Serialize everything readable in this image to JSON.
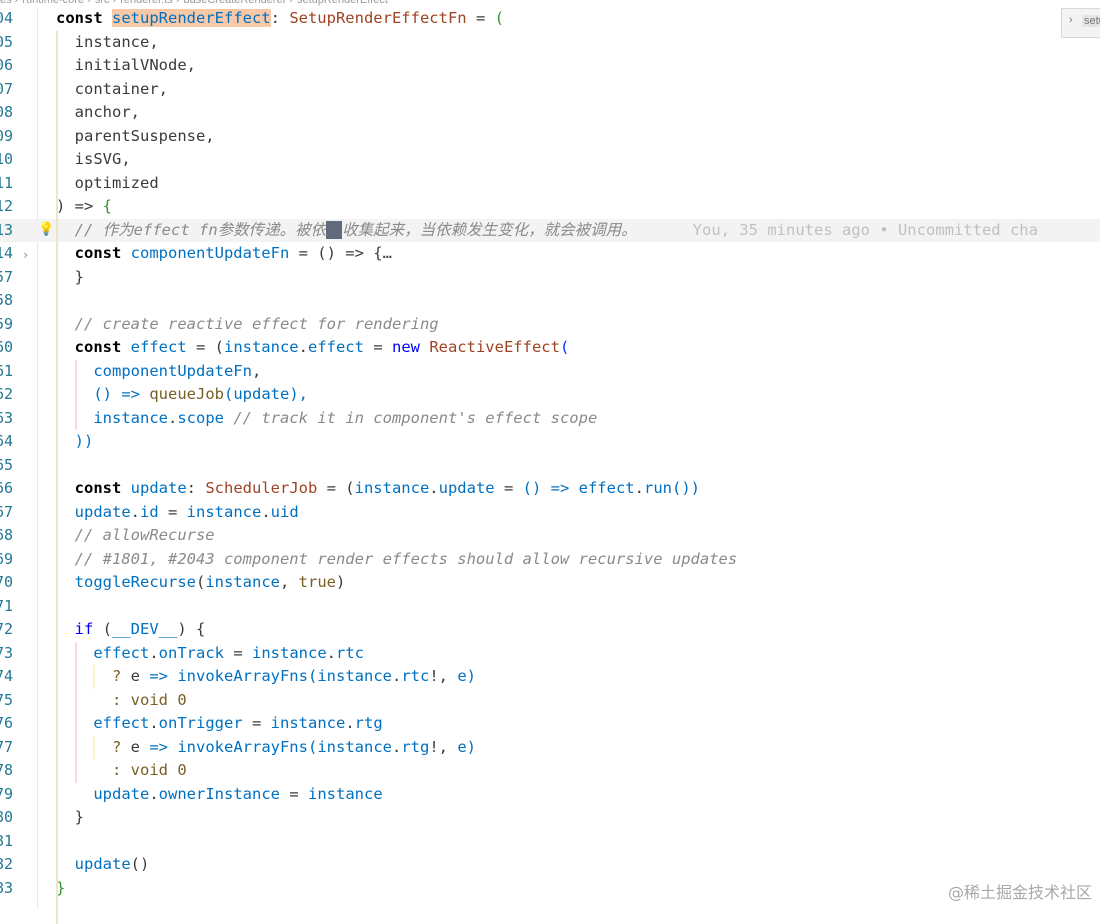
{
  "breadcrumb": [
    "es",
    "runtime-core",
    "src",
    "renderer.ts",
    "baseCreateRenderer",
    "setupRenderEffect"
  ],
  "minimap_widget": {
    "label": "setu"
  },
  "watermark": "@稀土掘金技术社区",
  "blame": {
    "text": "You, 35 minutes ago • Uncommitted cha"
  },
  "lines": [
    {
      "num": "04",
      "tokens": [
        [
          "const ",
          "bold"
        ],
        [
          "setupRenderEffect",
          "hl"
        ],
        [
          ": ",
          "pn"
        ],
        [
          "SetupRenderEffectFn",
          "cls"
        ],
        [
          " = ",
          "pn"
        ],
        [
          "(",
          "br2"
        ]
      ]
    },
    {
      "num": "05",
      "tokens": [
        [
          "  instance,",
          "pn"
        ]
      ]
    },
    {
      "num": "06",
      "tokens": [
        [
          "  initialVNode,",
          "pn"
        ]
      ]
    },
    {
      "num": "07",
      "tokens": [
        [
          "  container,",
          "pn"
        ]
      ]
    },
    {
      "num": "08",
      "tokens": [
        [
          "  anchor,",
          "pn"
        ]
      ]
    },
    {
      "num": "09",
      "tokens": [
        [
          "  parentSuspense,",
          "pn"
        ]
      ]
    },
    {
      "num": "10",
      "tokens": [
        [
          "  isSVG,",
          "pn"
        ]
      ]
    },
    {
      "num": "11",
      "tokens": [
        [
          "  optimized",
          "pn"
        ]
      ]
    },
    {
      "num": "12",
      "tokens": [
        [
          ") => ",
          "pn"
        ],
        [
          "{",
          "br2"
        ]
      ]
    },
    {
      "num": "13",
      "current": true,
      "tokens": [
        [
          "  // 作为effect fn参数传递。被依",
          "cm"
        ],
        [
          "CURSOR",
          "cursor"
        ],
        [
          "收集起来，当依赖发生变化，就会被调用。",
          "cm"
        ],
        [
          "      ",
          "pn"
        ],
        [
          "BLAME",
          "blame"
        ]
      ]
    },
    {
      "num": "14",
      "tokens": [
        [
          "  const ",
          "bold"
        ],
        [
          "componentUpdateFn",
          "var"
        ],
        [
          " = () => {…",
          "pn"
        ]
      ]
    },
    {
      "num": "57",
      "tokens": [
        [
          "  }",
          "pn"
        ]
      ]
    },
    {
      "num": "58",
      "tokens": []
    },
    {
      "num": "59",
      "tokens": [
        [
          "  // create reactive effect for rendering",
          "cm"
        ]
      ]
    },
    {
      "num": "60",
      "tokens": [
        [
          "  const ",
          "bold"
        ],
        [
          "effect",
          "var"
        ],
        [
          " = (",
          "pn"
        ],
        [
          "instance",
          "var"
        ],
        [
          ".",
          "pn"
        ],
        [
          "effect",
          "var"
        ],
        [
          " = ",
          "pn"
        ],
        [
          "new ",
          "kw"
        ],
        [
          "ReactiveEffect",
          "cls"
        ],
        [
          "(",
          "br1"
        ]
      ]
    },
    {
      "num": "61",
      "tokens": [
        [
          "    componentUpdateFn",
          "var"
        ],
        [
          ",",
          "pn"
        ]
      ]
    },
    {
      "num": "62",
      "tokens": [
        [
          "    () => ",
          "var"
        ],
        [
          "queueJob",
          "fn"
        ],
        [
          "(",
          "var"
        ],
        [
          "update",
          "var"
        ],
        [
          "),",
          "var"
        ]
      ]
    },
    {
      "num": "63",
      "tokens": [
        [
          "    instance",
          "var"
        ],
        [
          ".",
          "pn"
        ],
        [
          "scope",
          "var"
        ],
        [
          " // track it in component's effect scope",
          "cm"
        ]
      ]
    },
    {
      "num": "64",
      "tokens": [
        [
          "  ))",
          "var"
        ]
      ]
    },
    {
      "num": "65",
      "tokens": []
    },
    {
      "num": "66",
      "tokens": [
        [
          "  const ",
          "bold"
        ],
        [
          "update",
          "var"
        ],
        [
          ": ",
          "pn"
        ],
        [
          "SchedulerJob",
          "cls"
        ],
        [
          " = (",
          "pn"
        ],
        [
          "instance",
          "var"
        ],
        [
          ".",
          "pn"
        ],
        [
          "update",
          "var"
        ],
        [
          " = ",
          "pn"
        ],
        [
          "() => ",
          "var"
        ],
        [
          "effect",
          "var"
        ],
        [
          ".",
          "pn"
        ],
        [
          "run",
          "var"
        ],
        [
          "())",
          "var"
        ]
      ]
    },
    {
      "num": "67",
      "tokens": [
        [
          "  update",
          "var"
        ],
        [
          ".",
          "pn"
        ],
        [
          "id",
          "var"
        ],
        [
          " = ",
          "pn"
        ],
        [
          "instance",
          "var"
        ],
        [
          ".",
          "pn"
        ],
        [
          "uid",
          "var"
        ]
      ]
    },
    {
      "num": "68",
      "tokens": [
        [
          "  // allowRecurse",
          "cm"
        ]
      ]
    },
    {
      "num": "69",
      "tokens": [
        [
          "  // #1801, #2043 component render effects should allow recursive updates",
          "cm"
        ]
      ]
    },
    {
      "num": "70",
      "tokens": [
        [
          "  toggleRecurse",
          "var"
        ],
        [
          "(",
          "pn"
        ],
        [
          "instance",
          "var"
        ],
        [
          ", ",
          "pn"
        ],
        [
          "true",
          "fn"
        ],
        [
          ")",
          "pn"
        ]
      ]
    },
    {
      "num": "71",
      "tokens": []
    },
    {
      "num": "72",
      "tokens": [
        [
          "  if ",
          "kw"
        ],
        [
          "(",
          "pn"
        ],
        [
          "__DEV__",
          "var"
        ],
        [
          ") {",
          "pn"
        ]
      ]
    },
    {
      "num": "73",
      "tokens": [
        [
          "    effect",
          "var"
        ],
        [
          ".",
          "pn"
        ],
        [
          "onTrack",
          "var"
        ],
        [
          " = ",
          "pn"
        ],
        [
          "instance",
          "var"
        ],
        [
          ".",
          "pn"
        ],
        [
          "rtc",
          "var"
        ]
      ]
    },
    {
      "num": "74",
      "tokens": [
        [
          "      ? ",
          "fn"
        ],
        [
          "e",
          "pn"
        ],
        [
          " => ",
          "var"
        ],
        [
          "invokeArrayFns",
          "var"
        ],
        [
          "(",
          "var"
        ],
        [
          "instance",
          "var"
        ],
        [
          ".",
          "pn"
        ],
        [
          "rtc",
          "var"
        ],
        [
          "!, ",
          "pn"
        ],
        [
          "e",
          "var"
        ],
        [
          ")",
          "var"
        ]
      ]
    },
    {
      "num": "75",
      "tokens": [
        [
          "      : ",
          "fn"
        ],
        [
          "void ",
          "fn"
        ],
        [
          "0",
          "fn"
        ]
      ]
    },
    {
      "num": "76",
      "tokens": [
        [
          "    effect",
          "var"
        ],
        [
          ".",
          "pn"
        ],
        [
          "onTrigger",
          "var"
        ],
        [
          " = ",
          "pn"
        ],
        [
          "instance",
          "var"
        ],
        [
          ".",
          "pn"
        ],
        [
          "rtg",
          "var"
        ]
      ]
    },
    {
      "num": "77",
      "tokens": [
        [
          "      ? ",
          "fn"
        ],
        [
          "e",
          "pn"
        ],
        [
          " => ",
          "var"
        ],
        [
          "invokeArrayFns",
          "var"
        ],
        [
          "(",
          "var"
        ],
        [
          "instance",
          "var"
        ],
        [
          ".",
          "pn"
        ],
        [
          "rtg",
          "var"
        ],
        [
          "!, ",
          "pn"
        ],
        [
          "e",
          "var"
        ],
        [
          ")",
          "var"
        ]
      ]
    },
    {
      "num": "78",
      "tokens": [
        [
          "      : ",
          "fn"
        ],
        [
          "void ",
          "fn"
        ],
        [
          "0",
          "fn"
        ]
      ]
    },
    {
      "num": "79",
      "tokens": [
        [
          "    update",
          "var"
        ],
        [
          ".",
          "pn"
        ],
        [
          "ownerInstance",
          "var"
        ],
        [
          " = ",
          "pn"
        ],
        [
          "instance",
          "var"
        ]
      ]
    },
    {
      "num": "80",
      "tokens": [
        [
          "  }",
          "pn"
        ]
      ]
    },
    {
      "num": "81",
      "tokens": []
    },
    {
      "num": "82",
      "tokens": [
        [
          "  update",
          "var"
        ],
        [
          "()",
          "pn"
        ]
      ]
    },
    {
      "num": "83",
      "tokens": [
        [
          "}",
          "br2"
        ]
      ]
    }
  ]
}
